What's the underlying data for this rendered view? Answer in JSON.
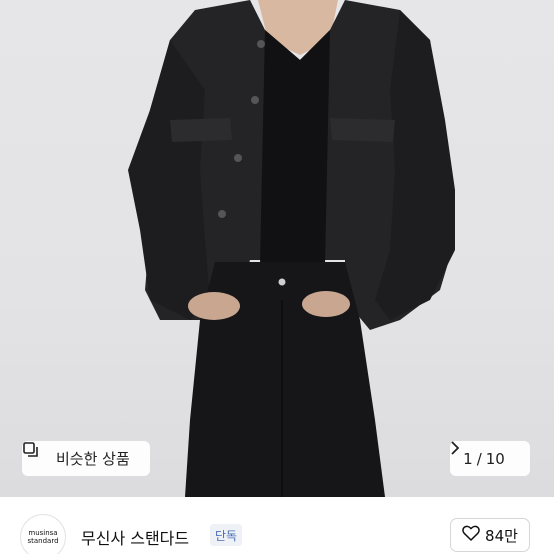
{
  "image_overlay": {
    "similar_button": {
      "label": "비슷한 상품",
      "icon": "similar-products-icon"
    },
    "pager": {
      "current": "1",
      "separator": "/",
      "total": "10",
      "next_icon": "chevron-right-icon"
    }
  },
  "brand": {
    "logo_line1": "musinsa",
    "logo_line2": "standard",
    "name": "무신사 스탠다드",
    "badge": "단독"
  },
  "like": {
    "icon": "heart-icon",
    "count": "84만"
  },
  "colors": {
    "badge_text": "#4b6fb5",
    "badge_bg": "#eef1f6"
  }
}
